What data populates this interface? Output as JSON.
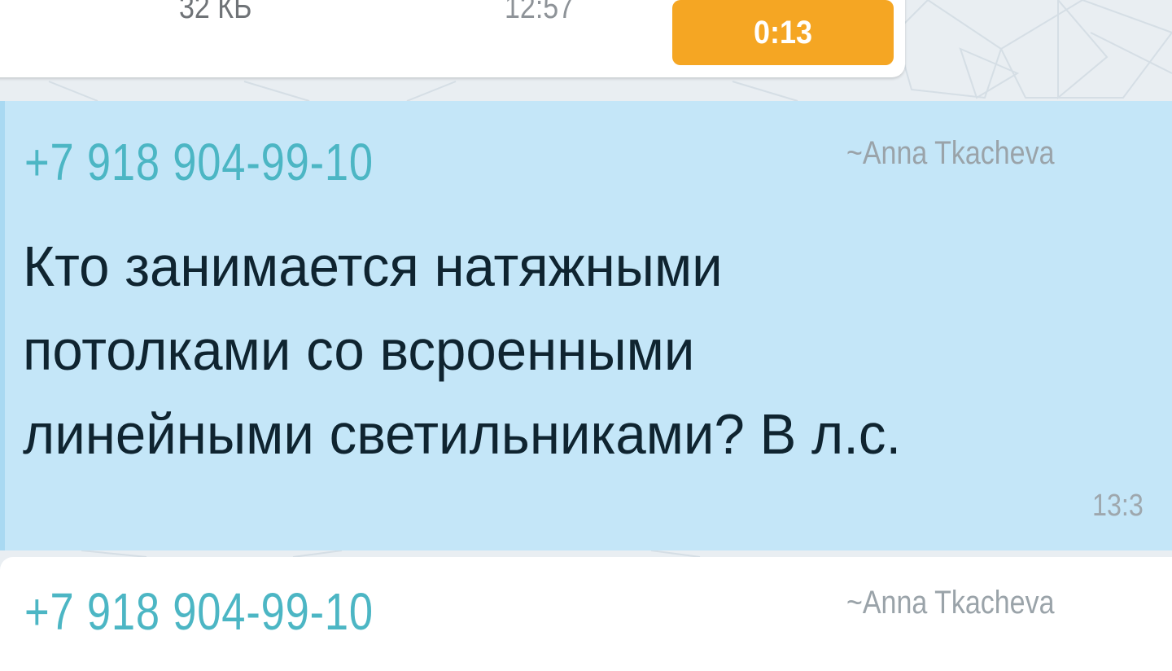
{
  "colors": {
    "accent_orange": "#f5a623",
    "phone_teal": "#4cb6c4",
    "highlight_bg": "#c4e6f8",
    "text_dark": "#0f2430"
  },
  "file_message": {
    "size": "32 КБ",
    "time": "12:57",
    "duration": "0:13"
  },
  "highlighted_message": {
    "sender_phone": "+7 918 904-99-10",
    "sender_name": "~Anna Tkacheva",
    "lines": [
      "Кто занимается натяжными",
      "потолками со всроенными",
      "линейными светильниками? В л.с."
    ],
    "time": "13:3"
  },
  "next_message": {
    "sender_phone": "+7 918 904-99-10",
    "sender_name": "~Anna Tkacheva"
  }
}
